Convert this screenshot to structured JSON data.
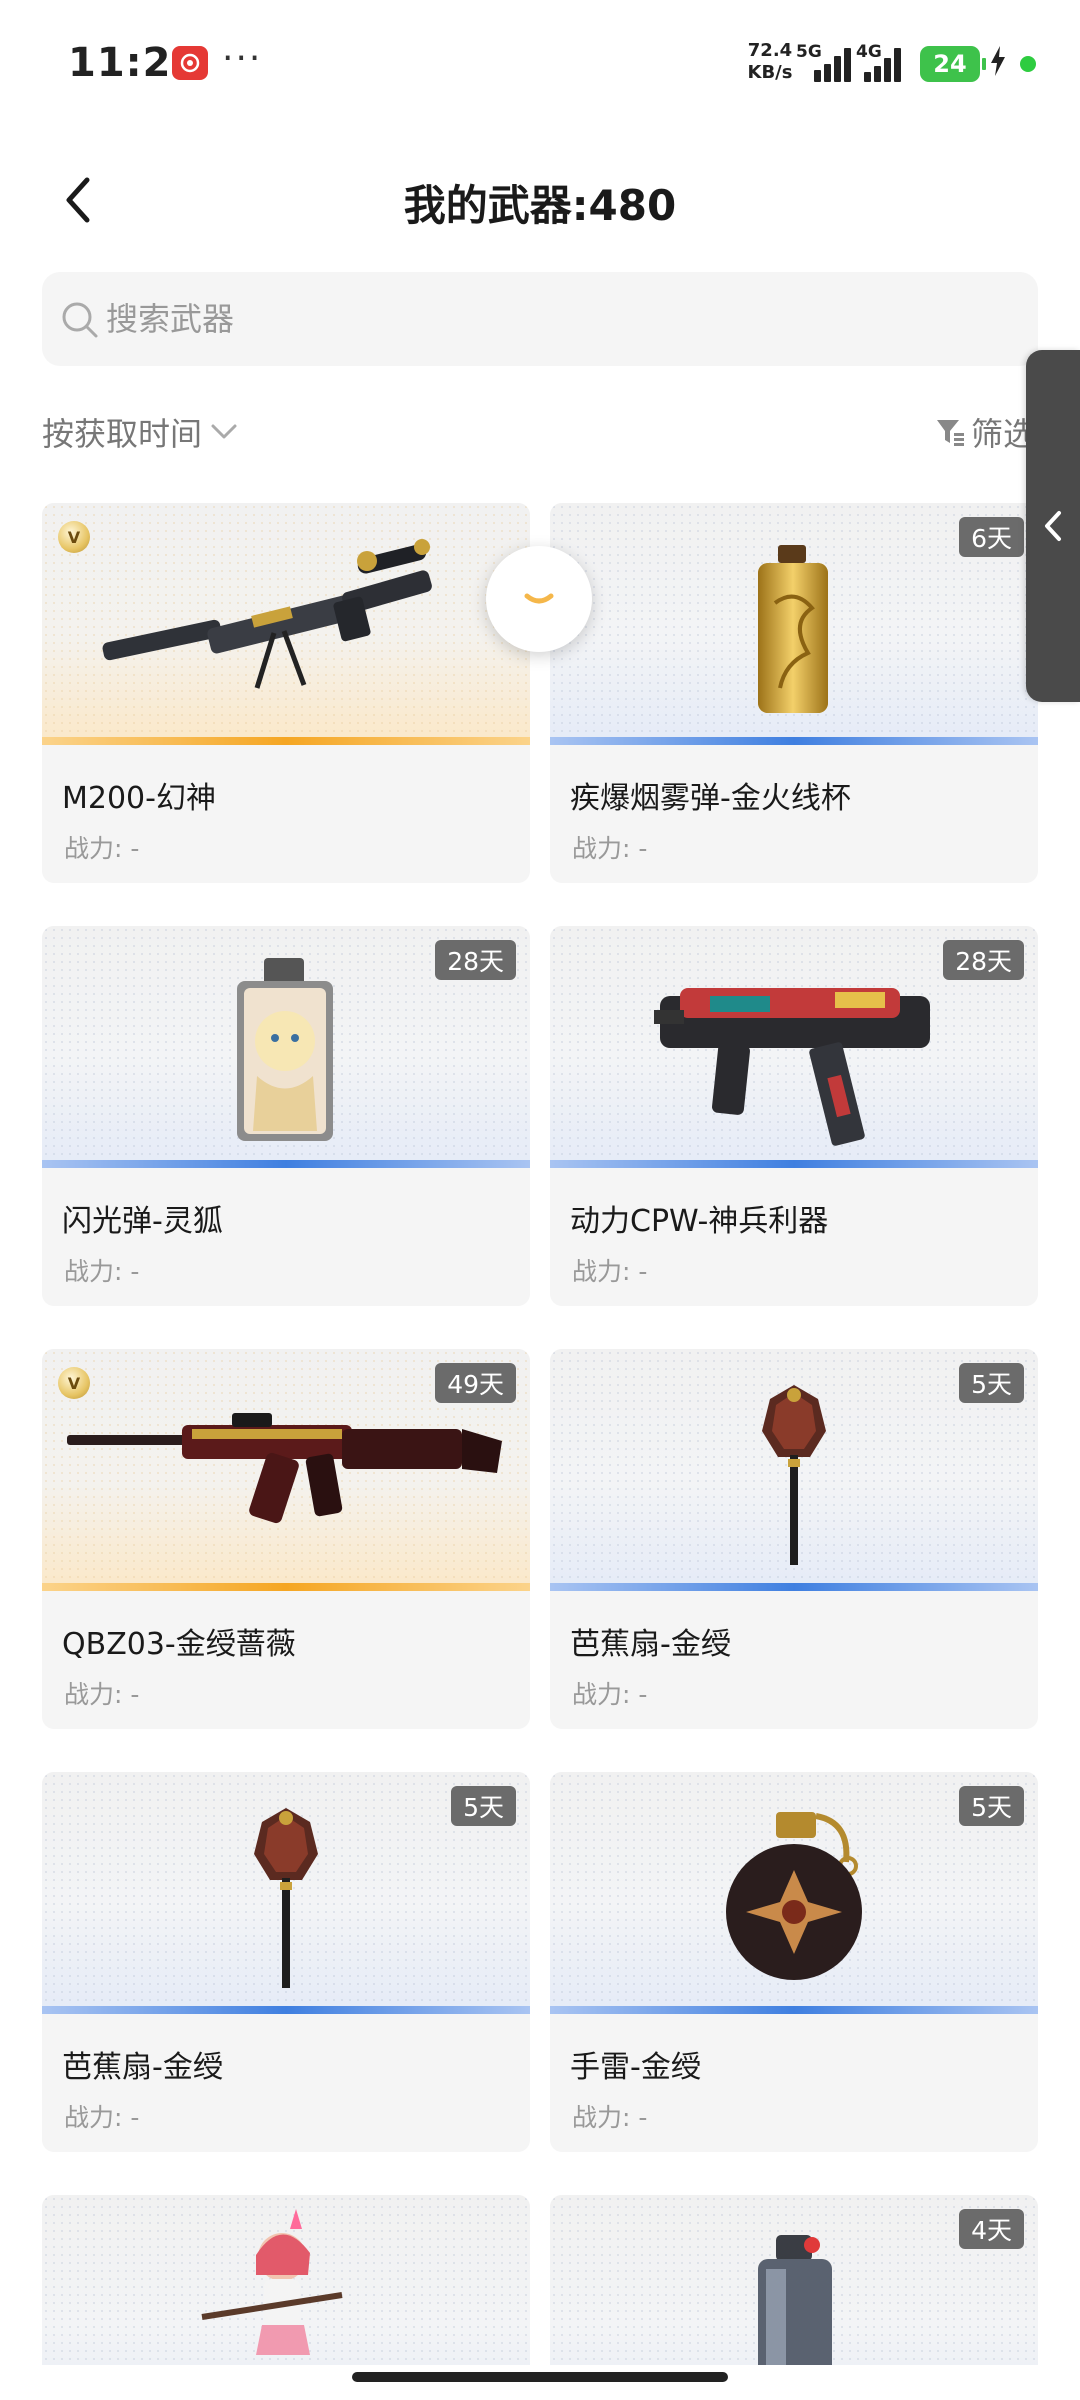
{
  "status_bar": {
    "time": "11:28",
    "more": "···",
    "net_speed": "72.4 KB/s",
    "net_speed_value": "72.4",
    "net_speed_unit": "KB/s",
    "signal1_label": "5G",
    "signal2_label": "4G",
    "battery": "24"
  },
  "header": {
    "title": "我的武器:480"
  },
  "search": {
    "placeholder": "搜索武器"
  },
  "toolbar": {
    "sort_label": "按获取时间",
    "filter_label": "筛选"
  },
  "colors": {
    "rarity_blue": "#3f7fe0",
    "rarity_gold": "#f5a623",
    "badge_bg": "#6b6b6b",
    "battery_green": "#3ec24b"
  },
  "weapons": [
    {
      "name": "M200-幻神",
      "power": "战力: -",
      "days": "",
      "vip": true,
      "rarity": "gold",
      "art": "sniper-rifle"
    },
    {
      "name": "疾爆烟雾弹-金火线杯",
      "power": "战力: -",
      "days": "6天",
      "vip": false,
      "rarity": "blue",
      "art": "smoke-grenade"
    },
    {
      "name": "闪光弹-灵狐",
      "power": "战力: -",
      "days": "28天",
      "vip": false,
      "rarity": "blue",
      "art": "flashbang"
    },
    {
      "name": "动力CPW-神兵利器",
      "power": "战力: -",
      "days": "28天",
      "vip": false,
      "rarity": "blue",
      "art": "smg"
    },
    {
      "name": "QBZ03-金绶蔷薇",
      "power": "战力: -",
      "days": "49天",
      "vip": true,
      "rarity": "gold",
      "art": "assault-rifle"
    },
    {
      "name": "芭蕉扇-金绶",
      "power": "战力: -",
      "days": "5天",
      "vip": false,
      "rarity": "blue",
      "art": "melee-fan"
    },
    {
      "name": "芭蕉扇-金绶",
      "power": "战力: -",
      "days": "5天",
      "vip": false,
      "rarity": "blue",
      "art": "melee-fan"
    },
    {
      "name": "手雷-金绶",
      "power": "战力: -",
      "days": "5天",
      "vip": false,
      "rarity": "blue",
      "art": "hand-grenade"
    },
    {
      "name": "",
      "power": "",
      "days": "",
      "vip": false,
      "rarity": "blue",
      "art": "character-sniper"
    },
    {
      "name": "",
      "power": "",
      "days": "4天",
      "vip": false,
      "rarity": "blue",
      "art": "canister"
    }
  ]
}
